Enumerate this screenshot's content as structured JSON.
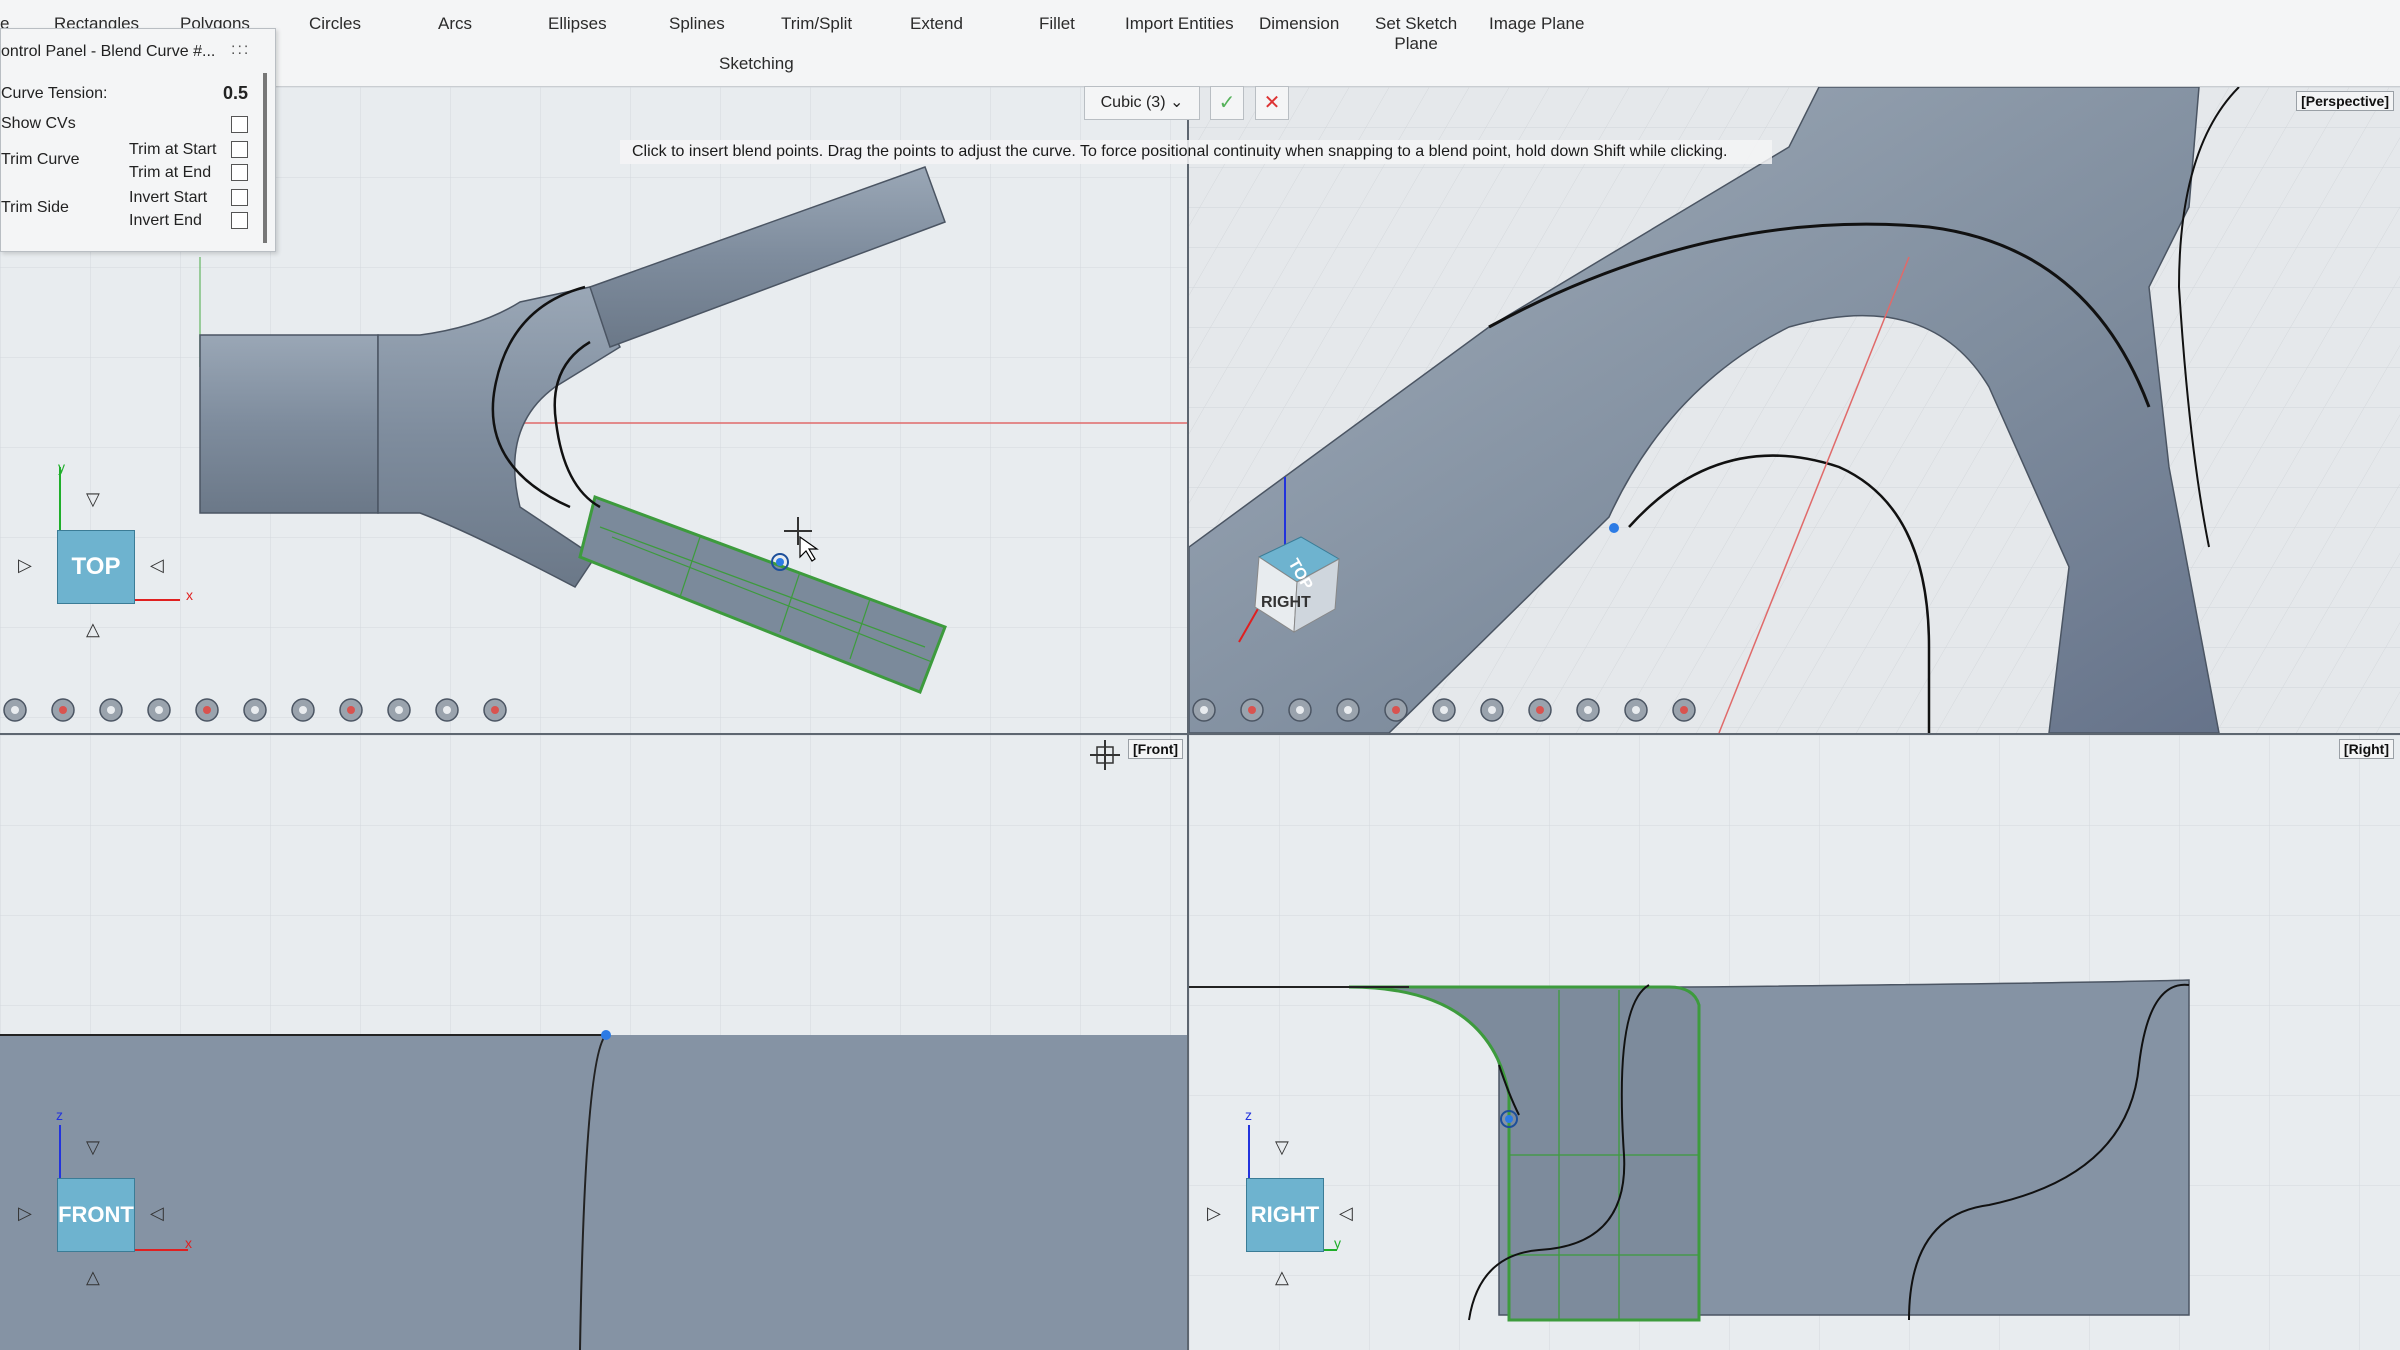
{
  "ribbon": {
    "items": [
      "e",
      "Rectangles",
      "Polygons",
      "Circles",
      "Arcs",
      "Ellipses",
      "Splines",
      "Trim/Split",
      "Extend",
      "Fillet",
      "Import Entities",
      "Dimension",
      "Set Sketch\nPlane",
      "Image Plane"
    ],
    "group_label": "Sketching"
  },
  "control_panel": {
    "title": "ontrol Panel - Blend Curve #...",
    "grip": ":::",
    "curve_tension_label": "Curve Tension:",
    "curve_tension_value": "0.5",
    "show_cvs_label": "Show CVs",
    "trim_curve_label": "Trim Curve",
    "trim_at_start_label": "Trim at Start",
    "trim_at_end_label": "Trim at End",
    "trim_side_label": "Trim Side",
    "invert_start_label": "Invert Start",
    "invert_end_label": "Invert End"
  },
  "curve_degree": {
    "selected": "Cubic (3)"
  },
  "hint_text": "Click to insert blend points. Drag the points to adjust the curve. To force positional continuity when snapping to a blend point, hold down Shift while clicking.",
  "viewports": {
    "perspective_label": "[Perspective]",
    "front_label": "[Front]",
    "right_label": "[Right]",
    "top_cube": "TOP",
    "front_cube": "FRONT",
    "right_cube": "RIGHT",
    "persp_cube_top": "TOP",
    "persp_cube_right": "RIGHT"
  },
  "axes": {
    "x": "x",
    "y": "y",
    "z": "z"
  },
  "icons": [
    "orbit-icon",
    "pan-icon",
    "home-icon",
    "zoom-fit-icon",
    "view-icon",
    "globe-icon",
    "shading-icon",
    "material-icon",
    "grid-icon",
    "zoom-icon",
    "display-icon"
  ],
  "colors": {
    "model": "#8593a4",
    "selection": "#3d9b3d",
    "accent": "#6eb3cf",
    "axis_x": "#e02020",
    "axis_y": "#1fae2a",
    "axis_z": "#2233dd"
  }
}
